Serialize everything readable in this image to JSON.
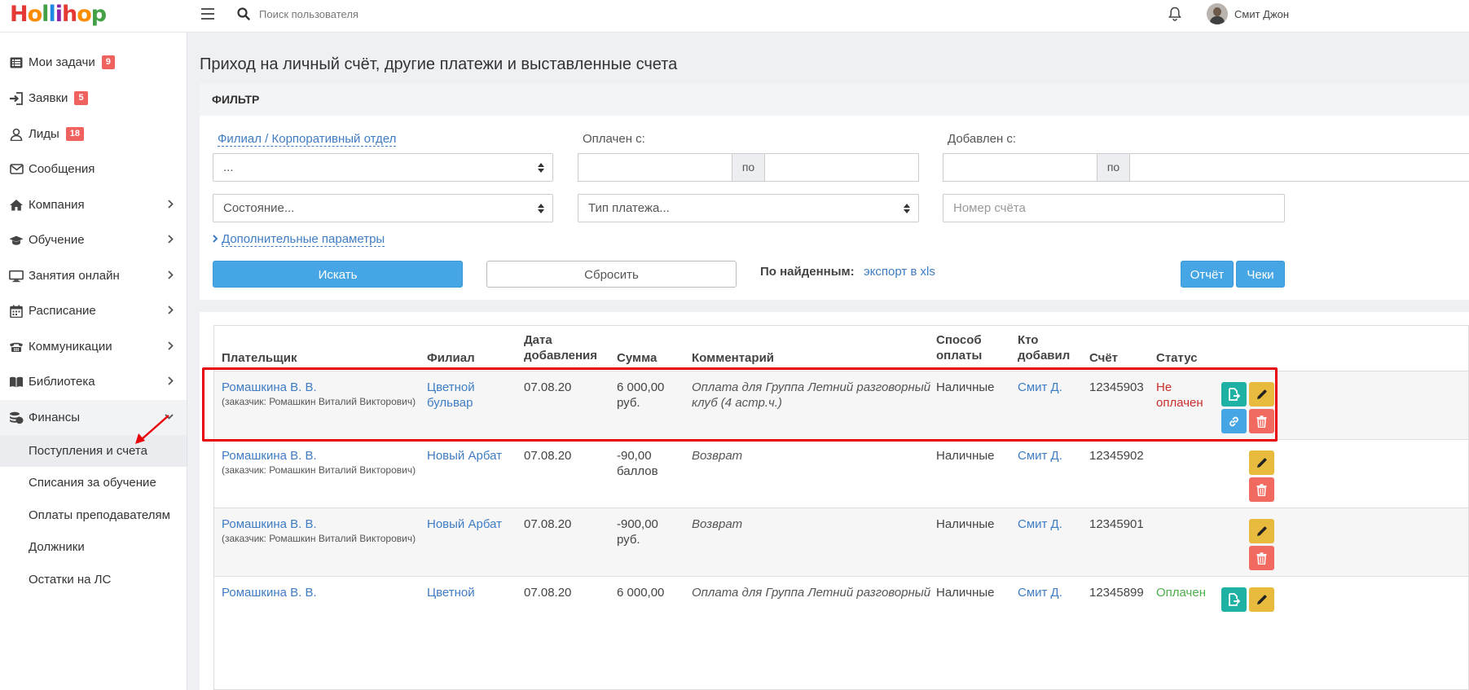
{
  "header": {
    "logo": [
      "H",
      "o",
      "l",
      "l",
      "i",
      "h",
      "o",
      "p"
    ],
    "search_placeholder": "Поиск пользователя",
    "user_name": "Смит Джон"
  },
  "sidebar": {
    "items": [
      {
        "label": "Мои задачи",
        "badge": "9",
        "icon": "tasks-icon"
      },
      {
        "label": "Заявки",
        "badge": "5",
        "icon": "sign-in-icon"
      },
      {
        "label": "Лиды",
        "badge": "18",
        "icon": "user-icon"
      },
      {
        "label": "Сообщения",
        "icon": "envelope-icon"
      },
      {
        "label": "Компания",
        "icon": "home-icon"
      },
      {
        "label": "Обучение",
        "icon": "graduation-cap-icon"
      },
      {
        "label": "Занятия онлайн",
        "icon": "monitor-icon"
      },
      {
        "label": "Расписание",
        "icon": "calendar-icon"
      },
      {
        "label": "Коммуникации",
        "icon": "phone-icon"
      },
      {
        "label": "Библиотека",
        "icon": "book-icon"
      },
      {
        "label": "Финансы",
        "icon": "coins-icon"
      }
    ],
    "sub_items": [
      {
        "label": "Поступления и счета"
      },
      {
        "label": "Списания за обучение"
      },
      {
        "label": "Оплаты преподавателям"
      },
      {
        "label": "Должники"
      },
      {
        "label": "Остатки на ЛС"
      }
    ]
  },
  "page": {
    "title": "Приход на личный счёт, другие платежи и выставленные счета"
  },
  "filter": {
    "heading": "ФИЛЬТР",
    "branch_label": "Филиал / Корпоративный отдел",
    "branch_value": "...",
    "paid_from_label": "Оплачен с:",
    "to_label": "по",
    "added_from_label": "Добавлен с:",
    "state_value": "Состояние...",
    "payment_type_value": "Тип платежа...",
    "invoice_placeholder": "Номер счёта",
    "more_params": "Дополнительные параметры",
    "search_btn": "Искать",
    "reset_btn": "Сбросить",
    "found_label": "По найденным:",
    "export_link": "экспорт в xls",
    "report_btn": "Отчёт",
    "checks_btn": "Чеки"
  },
  "table": {
    "headers": {
      "payer": "Плательщик",
      "branch": "Филиал",
      "date": [
        "Дата",
        "добавления"
      ],
      "amount": "Сумма",
      "comment": "Комментарий",
      "method": [
        "Способ",
        "оплаты"
      ],
      "added_by": [
        "Кто",
        "добавил"
      ],
      "invoice": "Счёт",
      "status": "Статус"
    },
    "rows": [
      {
        "payer": "Ромашкина В. В.",
        "customer": "(заказчик: Ромашкин Виталий Викторович)",
        "branch": [
          "Цветной",
          "бульвар"
        ],
        "date": "07.08.20",
        "amount": [
          "6 000,00",
          "руб."
        ],
        "comment": [
          "Оплата для Группа Летний разговорный",
          "клуб (4 астр.ч.)"
        ],
        "method": "Наличные",
        "added_by": "Смит Д.",
        "invoice": "12345903",
        "status": [
          "Не",
          "оплачен"
        ]
      },
      {
        "payer": "Ромашкина В. В.",
        "customer": "(заказчик: Ромашкин Виталий Викторович)",
        "branch": [
          "Новый Арбат",
          ""
        ],
        "date": "07.08.20",
        "amount": [
          "-90,00",
          "баллов"
        ],
        "comment": [
          "Возврат",
          ""
        ],
        "method": "Наличные",
        "added_by": "Смит Д.",
        "invoice": "12345902",
        "status": [
          "",
          ""
        ]
      },
      {
        "payer": "Ромашкина В. В.",
        "customer": "(заказчик: Ромашкин Виталий Викторович)",
        "branch": [
          "Новый Арбат",
          ""
        ],
        "date": "07.08.20",
        "amount": [
          "-900,00",
          "руб."
        ],
        "comment": [
          "Возврат",
          ""
        ],
        "method": "Наличные",
        "added_by": "Смит Д.",
        "invoice": "12345901",
        "status": [
          "",
          ""
        ]
      },
      {
        "payer": "Ромашкина В. В.",
        "customer": "",
        "branch": [
          "Цветной",
          ""
        ],
        "date": "07.08.20",
        "amount": [
          "6 000,00",
          ""
        ],
        "comment": [
          "Оплата для Группа Летний разговорный",
          ""
        ],
        "method": "Наличные",
        "added_by": "Смит Д.",
        "invoice": "12345899",
        "status": [
          "Оплачен",
          ""
        ]
      }
    ]
  },
  "colors": {
    "accent_blue": "#46a6e5",
    "link": "#3f7cc3",
    "badge": "#f0625e",
    "highlight": "#e8000b",
    "status_unpaid": "#c9302c",
    "status_paid": "#4cae4c"
  }
}
